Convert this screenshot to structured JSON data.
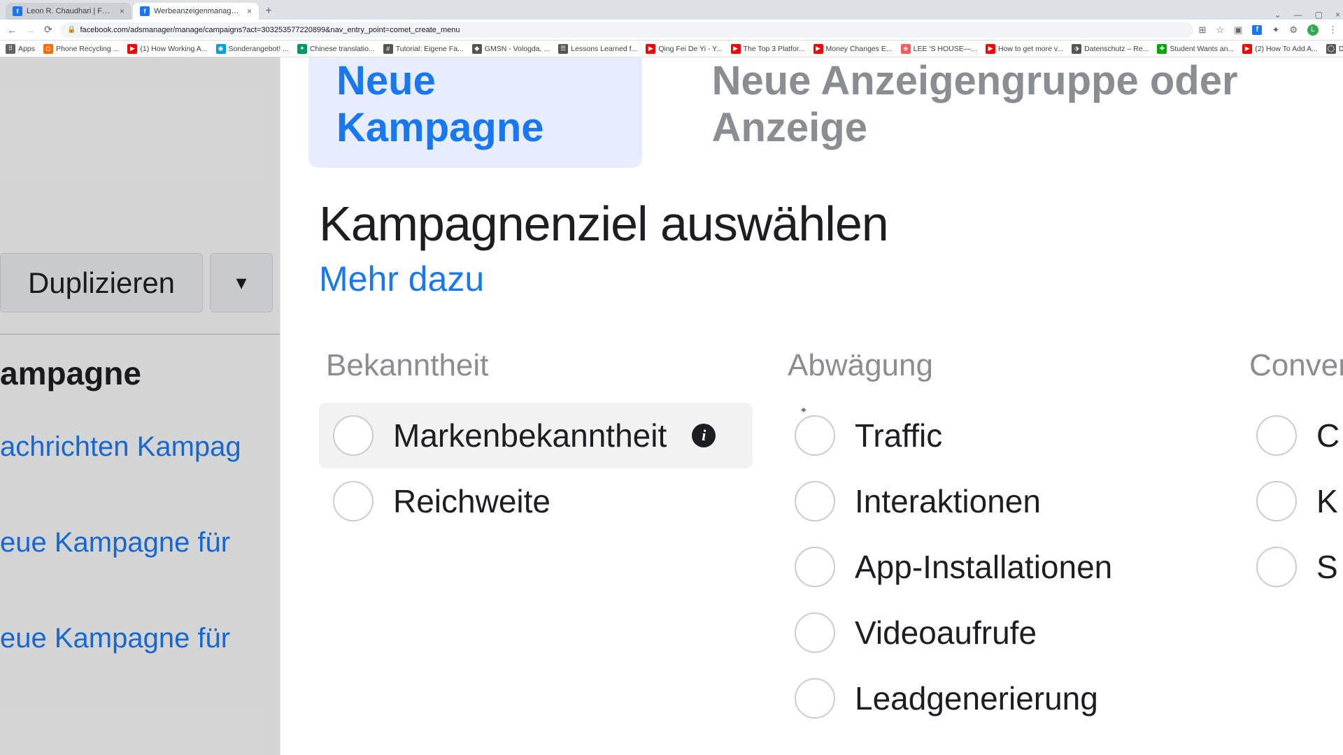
{
  "browser": {
    "tabs": [
      {
        "title": "Leon R. Chaudhari | Facebook",
        "active": false
      },
      {
        "title": "Werbeanzeigenmanager – We…",
        "active": true
      }
    ],
    "url": "facebook.com/adsmanager/manage/campaigns?act=303253577220899&nav_entry_point=comet_create_menu",
    "bookmarks": [
      {
        "label": "Apps",
        "color": "#5f6368"
      },
      {
        "label": "Phone Recycling ...",
        "color": "#ff6a00"
      },
      {
        "label": "(1) How Working A...",
        "color": "#ff0000"
      },
      {
        "label": "Sonderangebot! ...",
        "color": "#00a0dc"
      },
      {
        "label": "Chinese translatio...",
        "color": "#009966"
      },
      {
        "label": "Tutorial: Eigene Fa...",
        "color": "#555"
      },
      {
        "label": "GMSN - Vologda, ...",
        "color": "#555"
      },
      {
        "label": "Lessons Learned f...",
        "color": "#555"
      },
      {
        "label": "Qing Fei De Yi - Y...",
        "color": "#ff0000"
      },
      {
        "label": "The Top 3 Platfor...",
        "color": "#ff0000"
      },
      {
        "label": "Money Changes E...",
        "color": "#ff0000"
      },
      {
        "label": "LEE 'S HOUSE—...",
        "color": "#ff5a5f"
      },
      {
        "label": "How to get more v...",
        "color": "#ff0000"
      },
      {
        "label": "Datenschutz – Re...",
        "color": "#555"
      },
      {
        "label": "Student Wants an...",
        "color": "#00aa00"
      },
      {
        "label": "(2) How To Add A...",
        "color": "#ff0000"
      },
      {
        "label": "Download - Cooki...",
        "color": "#555"
      }
    ]
  },
  "sidebar": {
    "duplicate": "Duplizieren",
    "heading": "ampagne",
    "rows": [
      "achrichten Kampag",
      "eue Kampagne für",
      "eue Kampagne für"
    ]
  },
  "modal": {
    "tab_new_campaign": "Neue Kampagne",
    "tab_new_adset": "Neue Anzeigengruppe oder Anzeige",
    "heading": "Kampagnenziel auswählen",
    "learn_more": "Mehr dazu",
    "columns": {
      "awareness": {
        "title": "Bekanntheit",
        "options": [
          {
            "label": "Markenbekanntheit",
            "info": true,
            "hover": true
          },
          {
            "label": "Reichweite"
          }
        ]
      },
      "consideration": {
        "title": "Abwägung",
        "options": [
          {
            "label": "Traffic"
          },
          {
            "label": "Interaktionen"
          },
          {
            "label": "App-Installationen"
          },
          {
            "label": "Videoaufrufe"
          },
          {
            "label": "Leadgenerierung"
          }
        ]
      },
      "conversion": {
        "title": "Conversio",
        "options": [
          {
            "label": "C"
          },
          {
            "label": "K"
          },
          {
            "label": "S"
          }
        ]
      }
    }
  }
}
